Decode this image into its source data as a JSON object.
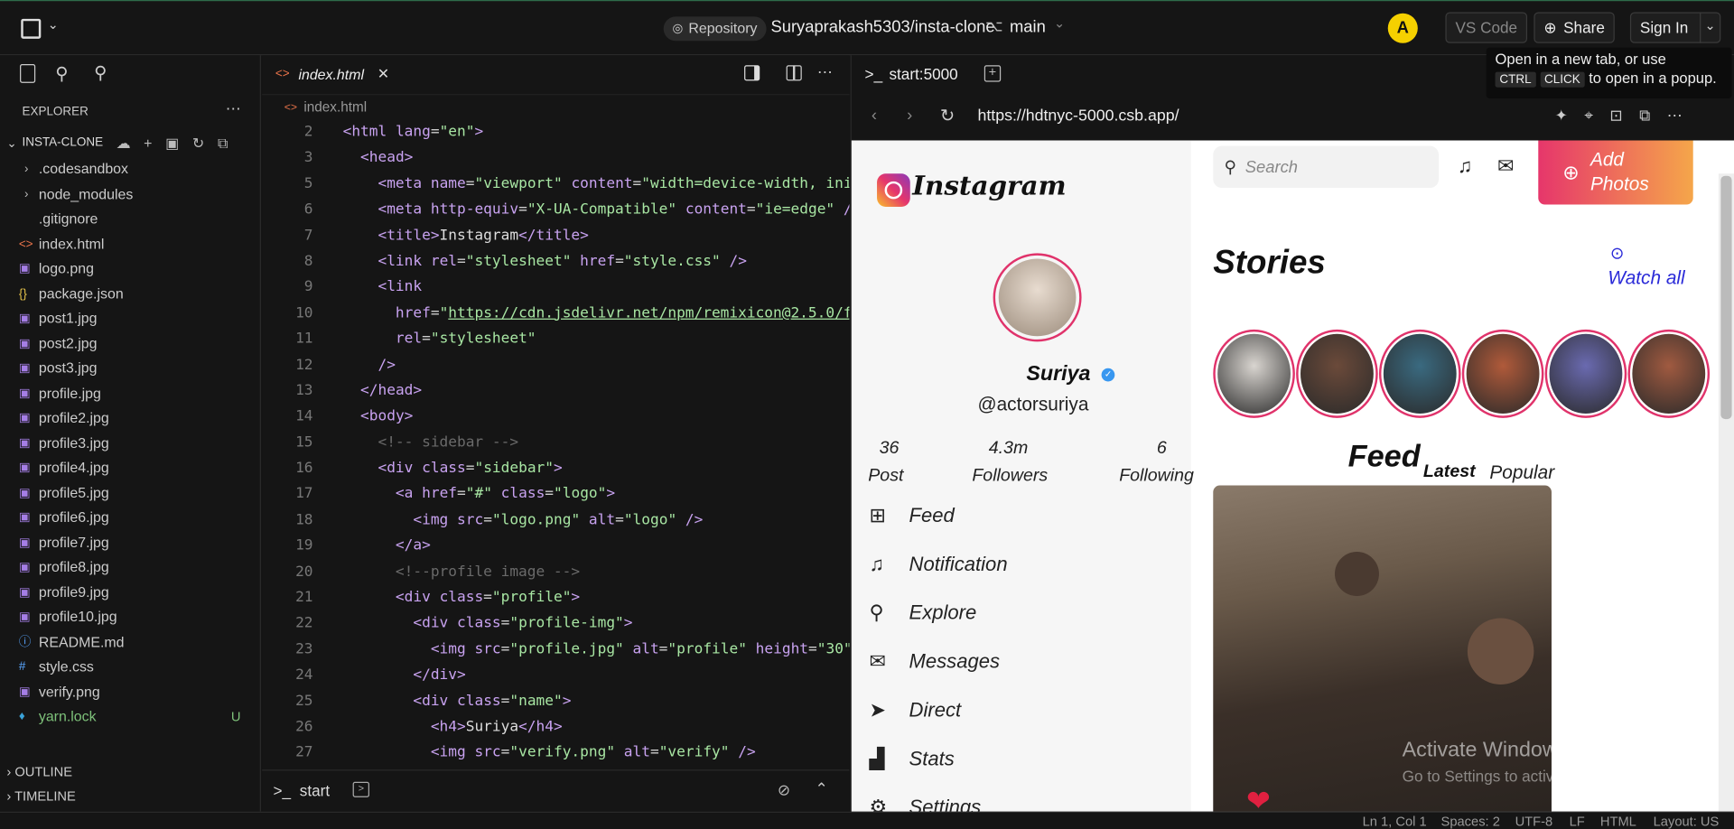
{
  "topbar": {
    "repo_badge": "Repository",
    "repo_name": "Suryaprakash5303/insta-clone",
    "branch": "main",
    "avatar_letter": "A",
    "vscode": "VS Code",
    "share": "Share",
    "signin": "Sign In"
  },
  "tooltip": {
    "line1": "Open in a new tab, or use",
    "key1": "CTRL",
    "key2": "CLICK",
    "line2": "to open in a popup."
  },
  "explorer": {
    "title": "EXPLORER",
    "project": "INSTA-CLONE",
    "files": [
      {
        "name": ".codesandbox",
        "kind": "folder"
      },
      {
        "name": "node_modules",
        "kind": "folder"
      },
      {
        "name": ".gitignore",
        "kind": "file"
      },
      {
        "name": "index.html",
        "kind": "html"
      },
      {
        "name": "logo.png",
        "kind": "img"
      },
      {
        "name": "package.json",
        "kind": "json"
      },
      {
        "name": "post1.jpg",
        "kind": "img"
      },
      {
        "name": "post2.jpg",
        "kind": "img"
      },
      {
        "name": "post3.jpg",
        "kind": "img"
      },
      {
        "name": "profile.jpg",
        "kind": "img"
      },
      {
        "name": "profile2.jpg",
        "kind": "img"
      },
      {
        "name": "profile3.jpg",
        "kind": "img"
      },
      {
        "name": "profile4.jpg",
        "kind": "img"
      },
      {
        "name": "profile5.jpg",
        "kind": "img"
      },
      {
        "name": "profile6.jpg",
        "kind": "img"
      },
      {
        "name": "profile7.jpg",
        "kind": "img"
      },
      {
        "name": "profile8.jpg",
        "kind": "img"
      },
      {
        "name": "profile9.jpg",
        "kind": "img"
      },
      {
        "name": "profile10.jpg",
        "kind": "img"
      },
      {
        "name": "README.md",
        "kind": "info"
      },
      {
        "name": "style.css",
        "kind": "css"
      },
      {
        "name": "verify.png",
        "kind": "img"
      },
      {
        "name": "yarn.lock",
        "kind": "yarn",
        "badge": "U"
      }
    ],
    "outline": "OUTLINE",
    "timeline": "TIMELINE"
  },
  "editor": {
    "tab": "index.html",
    "breadcrumb": "index.html",
    "terminal_tab": "start"
  },
  "code": [
    {
      "n": "2",
      "h": "<span class='tg'>&lt;html</span> <span class='at'>lang</span>=<span class='st'>\"en\"</span><span class='tg'>&gt;</span>",
      "i": 0
    },
    {
      "n": "3",
      "h": "  <span class='tg'>&lt;head&gt;</span>",
      "i": 0
    },
    {
      "n": "5",
      "h": "    <span class='tg'>&lt;meta</span> <span class='at'>name</span>=<span class='st'>\"viewport\"</span> <span class='at'>content</span>=<span class='st'>\"width=device-width, init</span>",
      "i": 0
    },
    {
      "n": "6",
      "h": "    <span class='tg'>&lt;meta</span> <span class='at'>http-equiv</span>=<span class='st'>\"X-UA-Compatible\"</span> <span class='at'>content</span>=<span class='st'>\"ie=edge\"</span> <span class='tg'>/&gt;</span>",
      "i": 0
    },
    {
      "n": "7",
      "h": "    <span class='tg'>&lt;title&gt;</span><span class='tx'>Instagram</span><span class='tg'>&lt;/title&gt;</span>",
      "i": 0
    },
    {
      "n": "8",
      "h": "    <span class='tg'>&lt;link</span> <span class='at'>rel</span>=<span class='st'>\"stylesheet\"</span> <span class='at'>href</span>=<span class='st'>\"style.css\"</span> <span class='tg'>/&gt;</span>",
      "i": 0
    },
    {
      "n": "9",
      "h": "    <span class='tg'>&lt;link</span>",
      "i": 0
    },
    {
      "n": "10",
      "h": "      <span class='at'>href</span>=<span class='st'>\"<u>https://cdn.jsdelivr.net/npm/remixicon@2.5.0/fo</u></span>",
      "i": 0
    },
    {
      "n": "11",
      "h": "      <span class='at'>rel</span>=<span class='st'>\"stylesheet\"</span>",
      "i": 0
    },
    {
      "n": "12",
      "h": "    <span class='tg'>/&gt;</span>",
      "i": 0
    },
    {
      "n": "13",
      "h": "  <span class='tg'>&lt;/head&gt;</span>",
      "i": 0
    },
    {
      "n": "14",
      "h": "  <span class='tg'>&lt;body&gt;</span>",
      "i": 0
    },
    {
      "n": "15",
      "h": "    <span class='cm'>&lt;!-- sidebar --&gt;</span>",
      "i": 0
    },
    {
      "n": "16",
      "h": "    <span class='tg'>&lt;div</span> <span class='at'>class</span>=<span class='st'>\"sidebar\"</span><span class='tg'>&gt;</span>",
      "i": 0
    },
    {
      "n": "17",
      "h": "      <span class='tg'>&lt;a</span> <span class='at'>href</span>=<span class='st'>\"#\"</span> <span class='at'>class</span>=<span class='st'>\"logo\"</span><span class='tg'>&gt;</span>",
      "i": 0
    },
    {
      "n": "18",
      "h": "        <span class='tg'>&lt;img</span> <span class='at'>src</span>=<span class='st'>\"logo.png\"</span> <span class='at'>alt</span>=<span class='st'>\"logo\"</span> <span class='tg'>/&gt;</span>",
      "i": 0
    },
    {
      "n": "19",
      "h": "      <span class='tg'>&lt;/a&gt;</span>",
      "i": 0
    },
    {
      "n": "20",
      "h": "      <span class='cm'>&lt;!--profile image --&gt;</span>",
      "i": 0
    },
    {
      "n": "21",
      "h": "      <span class='tg'>&lt;div</span> <span class='at'>class</span>=<span class='st'>\"profile\"</span><span class='tg'>&gt;</span>",
      "i": 0
    },
    {
      "n": "22",
      "h": "        <span class='tg'>&lt;div</span> <span class='at'>class</span>=<span class='st'>\"profile-img\"</span><span class='tg'>&gt;</span>",
      "i": 0
    },
    {
      "n": "23",
      "h": "          <span class='tg'>&lt;img</span> <span class='at'>src</span>=<span class='st'>\"profile.jpg\"</span> <span class='at'>alt</span>=<span class='st'>\"profile\"</span> <span class='at'>height</span>=<span class='st'>\"30\"</span>",
      "i": 0
    },
    {
      "n": "24",
      "h": "        <span class='tg'>&lt;/div&gt;</span>",
      "i": 0
    },
    {
      "n": "25",
      "h": "        <span class='tg'>&lt;div</span> <span class='at'>class</span>=<span class='st'>\"name\"</span><span class='tg'>&gt;</span>",
      "i": 0
    },
    {
      "n": "26",
      "h": "          <span class='tg'>&lt;h4&gt;</span><span class='tx'>Suriya</span><span class='tg'>&lt;/h4&gt;</span>",
      "i": 0
    },
    {
      "n": "27",
      "h": "          <span class='tg'>&lt;img</span> <span class='at'>src</span>=<span class='st'>\"verify.png\"</span> <span class='at'>alt</span>=<span class='st'>\"verify\"</span> <span class='tg'>/&gt;</span>",
      "i": 0
    }
  ],
  "browser": {
    "tab": "start:5000",
    "url": "https://hdtnyc-5000.csb.app/"
  },
  "insta": {
    "logo_text": "Instagram",
    "name": "Suriya",
    "handle": "@actorsuriya",
    "stats": [
      {
        "value": "36",
        "label": "Post"
      },
      {
        "value": "4.3m",
        "label": "Followers"
      },
      {
        "value": "6",
        "label": "Following"
      }
    ],
    "nav": [
      "Feed",
      "Notification",
      "Explore",
      "Messages",
      "Direct",
      "Stats",
      "Settings"
    ],
    "search_placeholder": "Search",
    "add_photos": "Add Photos",
    "stories_title": "Stories",
    "watch_all": "Watch all",
    "feed_title": "Feed",
    "feed_tab_latest": "Latest",
    "feed_tab_popular": "Popular",
    "story_colors": [
      "#d9d5d0",
      "#6b4a3a",
      "#3a6a80",
      "#b05a3a",
      "#6a6ab0",
      "#a05a40"
    ]
  },
  "watermark": {
    "line1": "Activate Windows",
    "line2": "Go to Settings to activate Windows."
  },
  "status": {
    "position": "Ln 1, Col 1",
    "spaces": "Spaces: 2",
    "encoding": "UTF-8",
    "eol": "LF",
    "language": "HTML",
    "layout": "Layout: US"
  }
}
